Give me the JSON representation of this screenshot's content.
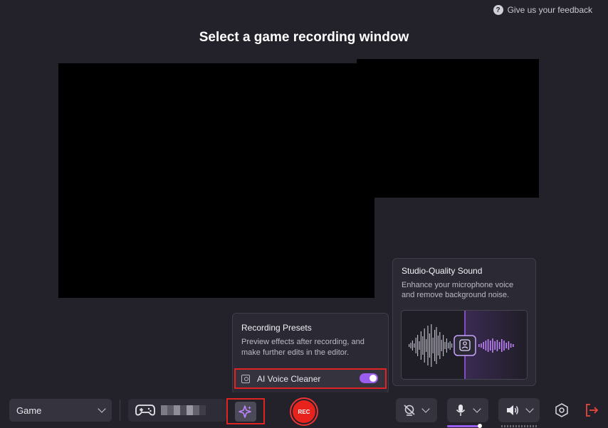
{
  "header": {
    "feedback_icon": "question-circle-icon",
    "feedback_label": "Give us your feedback",
    "title": "Select a game recording window"
  },
  "studio_popup": {
    "title": "Studio-Quality Sound",
    "description": "Enhance your microphone voice and remove background noise.",
    "accent_color": "#9b5cf0"
  },
  "presets_popup": {
    "title": "Recording Presets",
    "description": "Preview effects after recording, and make further edits in the editor.",
    "voice_cleaner_label": "AI Voice Cleaner",
    "voice_cleaner_enabled": true
  },
  "toolbar": {
    "mode_value": "Game",
    "rec_label": "REC",
    "rec_color": "#e8231e",
    "source_icon": "gamepad-icon",
    "ai_icon": "sparkle-icon",
    "camera_icon": "camera-off-icon",
    "mic_icon": "microphone-icon",
    "speaker_icon": "speaker-icon",
    "settings_icon": "settings-hexagon-icon",
    "exit_icon": "exit-icon",
    "exit_color": "#e8463c"
  }
}
